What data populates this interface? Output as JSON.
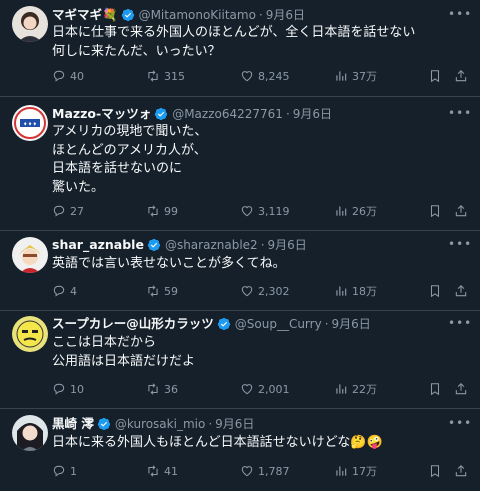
{
  "tweets": [
    {
      "name": "マギマギ💐",
      "handle": "@MitamonoKiitamo",
      "date": "9月6日",
      "lines": [
        "日本に仕事で来る外国人のほとんどが、全く日本語を話せない",
        "何しに来たんだ、いったい？"
      ],
      "replies": "40",
      "retweets": "315",
      "likes": "8,245",
      "views": "37万"
    },
    {
      "name": "Mazzo-マッツォ",
      "handle": "@Mazzo64227761",
      "date": "9月6日",
      "lines": [
        "アメリカの現地で聞いた、",
        "ほとんどのアメリカ人が、",
        "日本語を話せないのに",
        "驚いた。"
      ],
      "replies": "27",
      "retweets": "99",
      "likes": "3,119",
      "views": "26万"
    },
    {
      "name": "shar_aznable",
      "handle": "@sharaznable2",
      "date": "9月6日",
      "lines": [
        "英語では言い表せないことが多くてね。"
      ],
      "replies": "4",
      "retweets": "59",
      "likes": "2,302",
      "views": "18万"
    },
    {
      "name": "スープカレー@山形カラッツ",
      "handle": "@Soup__Curry",
      "date": "9月6日",
      "lines": [
        "ここは日本だから",
        "公用語は日本語だけだよ"
      ],
      "replies": "10",
      "retweets": "36",
      "likes": "2,001",
      "views": "22万"
    },
    {
      "name": "黒崎 澪",
      "handle": "@kurosaki_mio",
      "date": "9月6日",
      "lines": [
        "日本に来る外国人もほとんど日本語話せないけどな🤔🤪"
      ],
      "replies": "1",
      "retweets": "41",
      "likes": "1,787",
      "views": "17万"
    }
  ],
  "separator": "·",
  "colors": {
    "background": "#15202b",
    "text": "#f7f9f9",
    "muted": "#8b98a5",
    "verified": "#1d9bf0",
    "divider": "#38444d"
  },
  "icons": {
    "reply": "reply-icon",
    "retweet": "retweet-icon",
    "like": "heart-icon",
    "views": "views-icon",
    "bookmark": "bookmark-icon",
    "share": "share-icon",
    "verified": "verified-badge-icon",
    "more": "more-icon"
  }
}
